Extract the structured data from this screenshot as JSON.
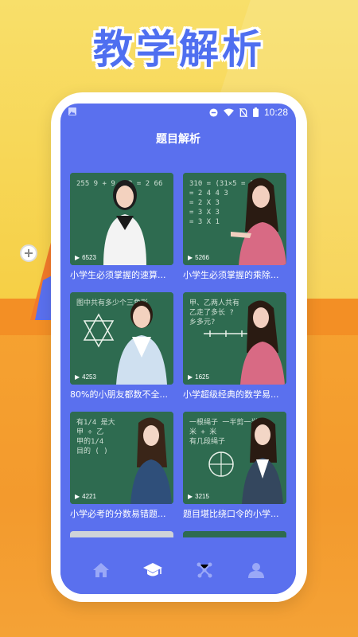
{
  "banner": {
    "headline": "教学解析"
  },
  "status": {
    "time": "10:28"
  },
  "page": {
    "title": "题目解析"
  },
  "videos": [
    {
      "title": "小学生必须掌握的速算...",
      "views": "6523",
      "board": [
        "255 9 + 9 · 2 = 2 66",
        ""
      ]
    },
    {
      "title": "小学生必须掌握的乘除...",
      "views": "5266",
      "board": [
        "310 = (31×5 = 1)",
        "= 2 4 4 3",
        "= 2 X 3",
        "= 3 X 3",
        "= 3 X 1"
      ]
    },
    {
      "title": "80%的小朋友都数不全...",
      "views": "4253",
      "board": [
        "图中共有多少个三角形"
      ]
    },
    {
      "title": "小学超级经典的数学易...",
      "views": "1625",
      "board": [
        "甲、乙两人共有",
        "乙走了多长 ?",
        "乡多元?"
      ]
    },
    {
      "title": "小学必考的分数易错题...",
      "views": "4221",
      "board": [
        "有1/4 是大",
        "甲 ÷ 乙",
        "甲的1/4",
        "目的 ( ) "
      ]
    },
    {
      "title": "题目堪比绕口令的小学...",
      "views": "3215",
      "board": [
        "一根绳子 一半剪一半",
        "米 + 米",
        "有几段绳子"
      ]
    }
  ],
  "tabs": [
    "home",
    "course",
    "tools",
    "profile"
  ],
  "colors": {
    "accent": "#5a70ee",
    "board": "#2e6b50",
    "banner_bg": "#f6cf45",
    "bottom_bg": "#f4a236"
  }
}
